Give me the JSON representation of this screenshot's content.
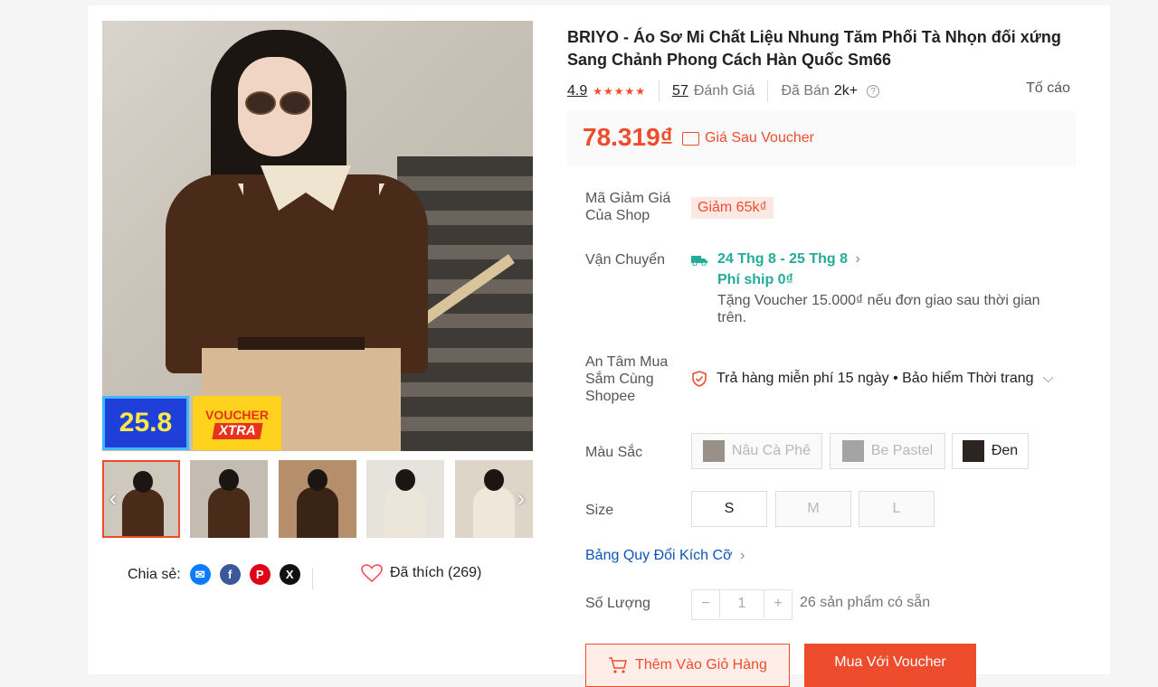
{
  "product": {
    "title": "BRIYO - Áo Sơ Mi Chất Liệu Nhung Tăm Phối Tà Nhọn đối xứng Sang Chảnh Phong Cách Hàn Quốc Sm66",
    "rating": "4.9",
    "rating_value": 4.9,
    "reviews_count": "57",
    "reviews_label": "Đánh Giá",
    "sold_label": "Đã Bán",
    "sold_count": "2k+",
    "report_label": "Tố cáo",
    "price": "78.319₫",
    "price_note": "Giá Sau Voucher"
  },
  "promo_badges": {
    "sale_day": "25.8",
    "voucher_line1": "VOUCHER",
    "voucher_line2": "XTRA"
  },
  "gallery": {
    "thumbnail_count": 5,
    "active_index": 0
  },
  "share": {
    "label": "Chia sẻ:",
    "icons": [
      "messenger-icon",
      "facebook-icon",
      "pinterest-icon",
      "x-icon"
    ]
  },
  "liked": {
    "label": "Đã thích (269)"
  },
  "details": {
    "shop_voucher_label": "Mã Giảm Giá Của Shop",
    "shop_voucher_value": "Giảm 65k₫",
    "shipping_label": "Vận Chuyển",
    "shipping_date": "24 Thg 8 - 25 Thg 8",
    "shipping_fee": "Phí ship 0₫",
    "shipping_note": "Tặng Voucher 15.000₫ nếu đơn giao sau thời gian trên.",
    "assurance_label": "An Tâm Mua Sắm Cùng Shopee",
    "assurance_value": "Trả hàng miễn phí 15 ngày • Bảo hiểm Thời trang"
  },
  "colors": {
    "label": "Màu Sắc",
    "options": [
      {
        "name": "Nâu Cà Phê",
        "available": false
      },
      {
        "name": "Be Pastel",
        "available": false
      },
      {
        "name": "Đen",
        "available": true
      }
    ]
  },
  "sizes": {
    "label": "Size",
    "options": [
      {
        "name": "S",
        "available": true
      },
      {
        "name": "M",
        "available": false
      },
      {
        "name": "L",
        "available": false
      }
    ]
  },
  "size_guide": "Bảng Quy Đổi Kích Cỡ",
  "quantity": {
    "label": "Số Lượng",
    "value": "1",
    "minus": "−",
    "plus": "+",
    "stock": "26 sản phẩm có sẵn"
  },
  "actions": {
    "add_to_cart": "Thêm Vào Giỏ Hàng",
    "buy_with_voucher": "Mua Với Voucher"
  },
  "colors_theme": {
    "accent": "#ee4d2d",
    "ship_green": "#26aa99",
    "link_blue": "#0d54b7"
  }
}
